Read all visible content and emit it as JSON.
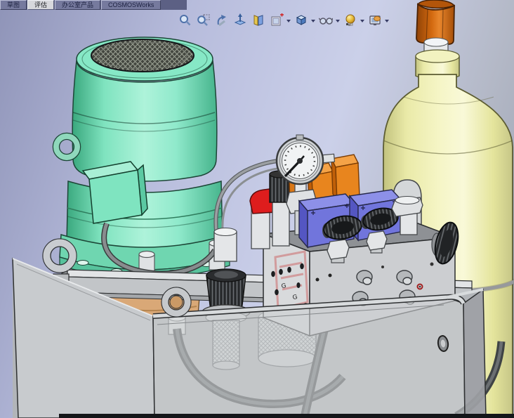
{
  "command_tabs": {
    "items": [
      {
        "label": "草图",
        "active": false
      },
      {
        "label": "评估",
        "active": true
      },
      {
        "label": "办公室产品",
        "active": false
      },
      {
        "label": "COSMOSWorks",
        "active": false
      }
    ]
  },
  "view_toolbar": {
    "items": [
      {
        "name": "zoom-to-fit",
        "has_dropdown": false
      },
      {
        "name": "zoom-to-area",
        "has_dropdown": false
      },
      {
        "name": "previous-view",
        "has_dropdown": false
      },
      {
        "name": "normal-to",
        "has_dropdown": false
      },
      {
        "name": "section-view",
        "has_dropdown": false
      },
      {
        "name": "view-orientation",
        "has_dropdown": true
      },
      {
        "name": "display-style",
        "has_dropdown": true
      },
      {
        "name": "hide-show-items",
        "has_dropdown": true
      },
      {
        "name": "edit-appearance",
        "has_dropdown": true
      },
      {
        "name": "apply-scene",
        "has_dropdown": true
      }
    ]
  },
  "scene": {
    "description": "3D CAD model of a hydraulic power unit assembly",
    "port_marking": "G",
    "colors": {
      "background_top_right": "#cdd2ea",
      "background_bottom_left": "#9298b4",
      "motor_teal": "#7fe3bf",
      "accumulator_yellow": "#f2f2b8",
      "accumulator_cap_orange": "#cc660f",
      "valve_blue": "#7175dc",
      "solenoid_coil_orange": "#e8851e",
      "red_accent": "#de1d1d",
      "tank_gray": "#cdd0d2",
      "watermark_red": "#c41c1c"
    },
    "components": [
      {
        "id": "electric-motor",
        "color": "#7fe3bf"
      },
      {
        "id": "motor-fan-cover",
        "color": "#43463f"
      },
      {
        "id": "motor-junction-box",
        "color": "#7fe4c0"
      },
      {
        "id": "motor-cable",
        "color": "#888c8e"
      },
      {
        "id": "lifting-eyebolt",
        "color": "#c9ccd0"
      },
      {
        "id": "mounting-beam",
        "color": "#c2c5c8"
      },
      {
        "id": "hydraulic-tank",
        "color": "#cdd0d2"
      },
      {
        "id": "breather-cap",
        "color": "#2a2c2e"
      },
      {
        "id": "suction-filter",
        "color": "#d6d9db"
      },
      {
        "id": "return-filter",
        "color": "#d6d9db"
      },
      {
        "id": "manifold-block",
        "color": "#ccced1"
      },
      {
        "id": "solenoid-valve",
        "color": "#7175dc"
      },
      {
        "id": "solenoid-coil",
        "color": "#e8851e"
      },
      {
        "id": "pressure-gauge",
        "color": "#f1f3f4"
      },
      {
        "id": "hand-knob",
        "color": "#26282a"
      },
      {
        "id": "red-filler-cap",
        "color": "#de1d1d"
      },
      {
        "id": "accumulator-bottle",
        "color": "#f2f2b8"
      },
      {
        "id": "accumulator-cap",
        "color": "#cc660f"
      },
      {
        "id": "hose",
        "color": "#3f4345"
      }
    ]
  }
}
